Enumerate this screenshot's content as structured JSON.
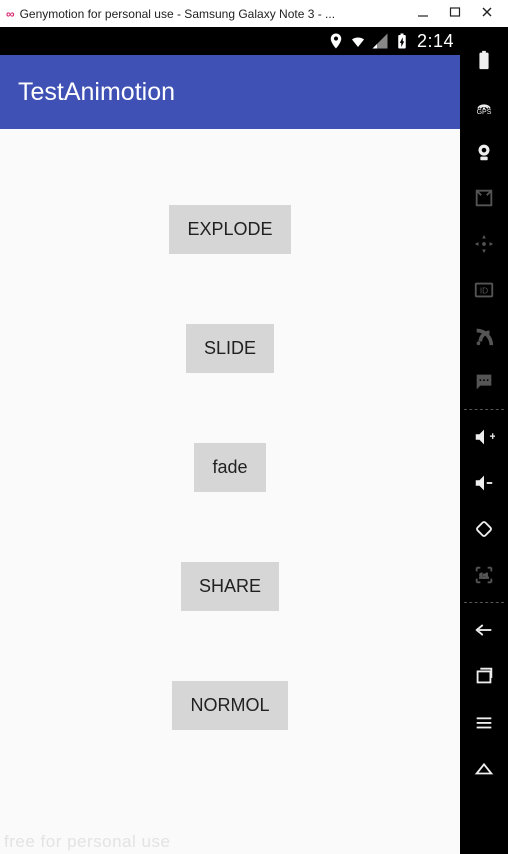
{
  "window": {
    "title": "Genymotion for personal use - Samsung Galaxy Note 3 - ..."
  },
  "statusbar": {
    "time": "2:14"
  },
  "appbar": {
    "title": "TestAnimotion"
  },
  "buttons": {
    "explode": "EXPLODE",
    "slide": "SLIDE",
    "fade": "fade",
    "share": "SHARE",
    "normol": "NORMOL"
  },
  "sidebar": {
    "gps_label": "GPS"
  },
  "watermark": "free for personal use"
}
